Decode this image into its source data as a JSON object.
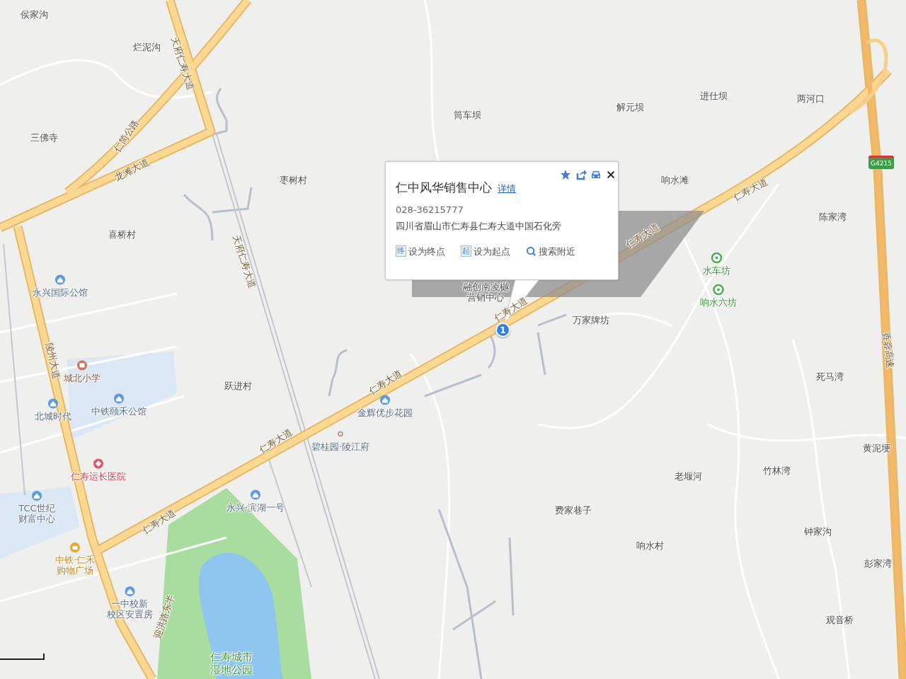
{
  "map": {
    "labels": [
      {
        "kind": "place",
        "lines": [
          "侯家沟"
        ]
      },
      {
        "kind": "place",
        "lines": [
          "烂泥沟"
        ]
      },
      {
        "kind": "road",
        "lines": [
          "天府仁寿大道"
        ]
      },
      {
        "kind": "road",
        "lines": [
          "仁简公路"
        ]
      },
      {
        "kind": "place",
        "lines": [
          "三佛寺"
        ]
      },
      {
        "kind": "road",
        "lines": [
          "龙滩大道"
        ]
      },
      {
        "kind": "place",
        "lines": [
          "枣树村"
        ]
      },
      {
        "kind": "place",
        "lines": [
          "筒车坝"
        ]
      },
      {
        "kind": "place",
        "lines": [
          "解元坝"
        ]
      },
      {
        "kind": "place",
        "lines": [
          "进仕坝"
        ]
      },
      {
        "kind": "place",
        "lines": [
          "两河口"
        ]
      },
      {
        "kind": "place",
        "lines": [
          "响水滩"
        ]
      },
      {
        "kind": "road",
        "lines": [
          "仁寿大道"
        ]
      },
      {
        "kind": "place",
        "lines": [
          "陈家湾"
        ]
      },
      {
        "kind": "place",
        "lines": [
          "喜桥村"
        ]
      },
      {
        "kind": "road",
        "lines": [
          "天府仁寿大道"
        ]
      },
      {
        "kind": "road",
        "lines": [
          "仁寿大道"
        ]
      },
      {
        "kind": "residence",
        "lines": [
          "永兴国际公馆"
        ]
      },
      {
        "kind": "scenic",
        "lines": [
          "水车坊"
        ]
      },
      {
        "kind": "scenic",
        "lines": [
          "响水六坊"
        ]
      },
      {
        "kind": "place",
        "lines": [
          "融创南凌樾",
          "营销中心"
        ]
      },
      {
        "kind": "road",
        "lines": [
          "仁寿大道"
        ]
      },
      {
        "kind": "place",
        "lines": [
          "万家牌坊"
        ]
      },
      {
        "kind": "road",
        "lines": [
          "陵州大道"
        ]
      },
      {
        "kind": "school",
        "lines": [
          "城北小学"
        ]
      },
      {
        "kind": "place",
        "lines": [
          "跃进村"
        ]
      },
      {
        "kind": "road",
        "lines": [
          "仁寿大道"
        ]
      },
      {
        "kind": "residence",
        "lines": [
          "中铁颐禾公馆"
        ]
      },
      {
        "kind": "residence",
        "lines": [
          "北城时代"
        ]
      },
      {
        "kind": "residence",
        "lines": [
          "金辉优步花园"
        ]
      },
      {
        "kind": "place",
        "lines": [
          "死马湾"
        ]
      },
      {
        "kind": "road",
        "lines": [
          "香蓉高速"
        ]
      },
      {
        "kind": "estate",
        "lines": [
          "碧桂园·陵江府"
        ]
      },
      {
        "kind": "place",
        "lines": [
          "黄泥埂"
        ]
      },
      {
        "kind": "hospital",
        "lines": [
          "仁寿运长医院"
        ]
      },
      {
        "kind": "road",
        "lines": [
          "仁寿大道"
        ]
      },
      {
        "kind": "place",
        "lines": [
          "老堰河"
        ]
      },
      {
        "kind": "place",
        "lines": [
          "竹林湾"
        ]
      },
      {
        "kind": "residence",
        "lines": [
          "TCC世纪",
          "财富中心"
        ]
      },
      {
        "kind": "residence",
        "lines": [
          "永兴·滨湖一号"
        ]
      },
      {
        "kind": "place",
        "lines": [
          "费家巷子"
        ]
      },
      {
        "kind": "road",
        "lines": [
          "仁寿大道"
        ]
      },
      {
        "kind": "place",
        "lines": [
          "响水村"
        ]
      },
      {
        "kind": "place",
        "lines": [
          "钟家沟"
        ]
      },
      {
        "kind": "mall",
        "lines": [
          "中铁·仁禾",
          "购物广场"
        ]
      },
      {
        "kind": "place",
        "lines": [
          "彭家湾"
        ]
      },
      {
        "kind": "residence",
        "lines": [
          "一中校新",
          "校区安置房"
        ]
      },
      {
        "kind": "road",
        "lines": [
          "迎洪路东半"
        ]
      },
      {
        "kind": "place",
        "lines": [
          "观音桥"
        ]
      },
      {
        "kind": "park",
        "lines": [
          "仁寿城市",
          "湿地公园"
        ]
      }
    ],
    "highway_shield": "G4215",
    "marker": {
      "text": "1"
    }
  },
  "popup": {
    "title": "仁中风华销售中心",
    "detail_link": "详情",
    "phone": "028-36215777",
    "address": "四川省眉山市仁寿县仁寿大道中国石化旁",
    "actions": [
      {
        "kind": "letter",
        "icon_text": "终",
        "label": "设为终点"
      },
      {
        "kind": "letter",
        "icon_text": "起",
        "label": "设为起点"
      },
      {
        "kind": "search",
        "label": "搜索附近"
      }
    ]
  }
}
